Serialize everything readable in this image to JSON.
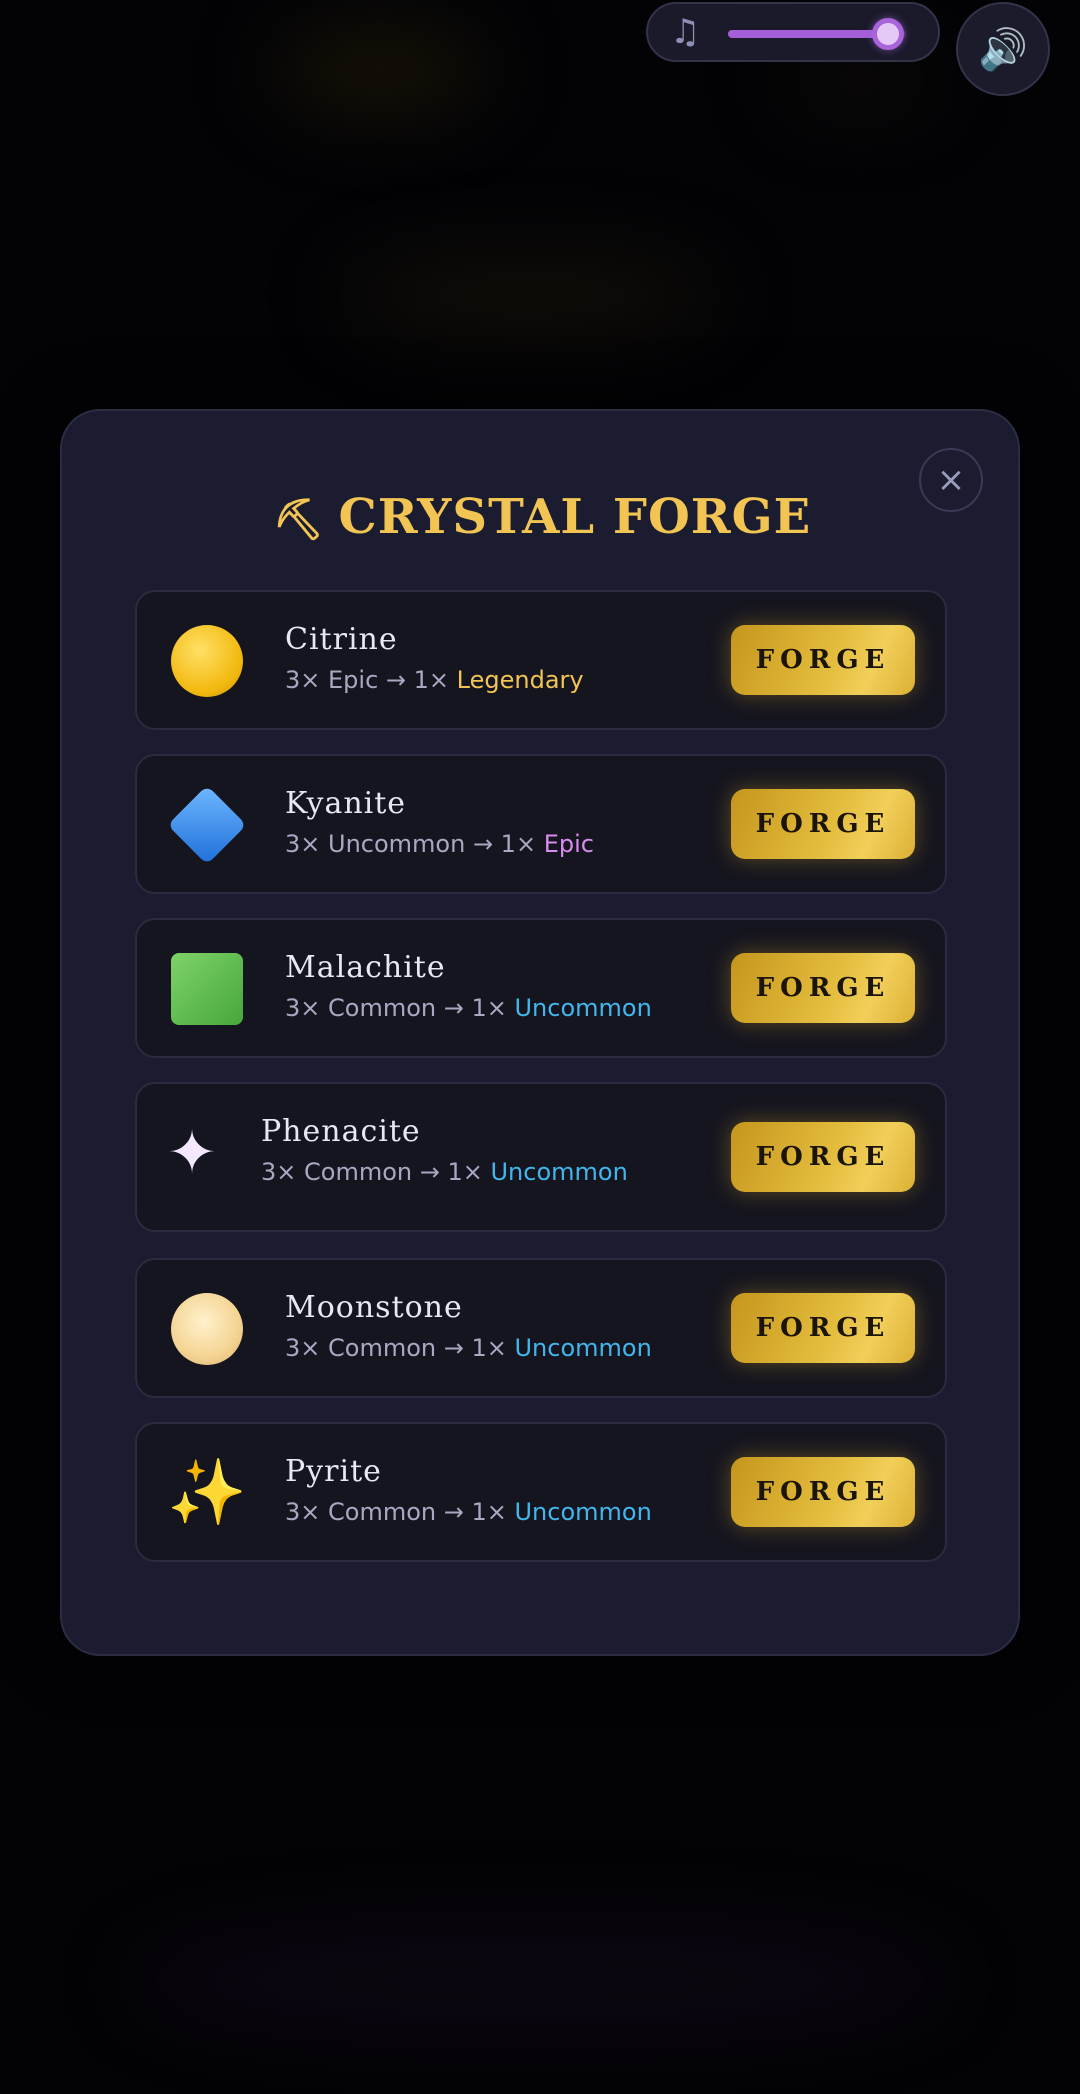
{
  "controls": {
    "music_icon": "music-note-icon",
    "music_volume": 0.9,
    "sound_icon": "speaker-icon",
    "colors": {
      "slider_fill": "#a55fd6",
      "slider_thumb": "#e4c8f6"
    }
  },
  "modal": {
    "title_icon": "⛏",
    "title": "CRYSTAL FORGE",
    "close_icon": "×",
    "colors": {
      "title": "#f1c453",
      "legendary": "#f1c453",
      "epic": "#d88cf0",
      "uncommon": "#42b6ec"
    },
    "recipes": [
      {
        "name": "Citrine",
        "icon": "citrine-gem-icon",
        "input": "3× Epic → 1× ",
        "output": "Legendary",
        "button": "FORGE"
      },
      {
        "name": "Kyanite",
        "icon": "kyanite-gem-icon",
        "input": "3× Uncommon → 1× ",
        "output": "Epic",
        "button": "FORGE"
      },
      {
        "name": "Malachite",
        "icon": "malachite-gem-icon",
        "input": "3× Common → 1× ",
        "output": "Uncommon",
        "button": "FORGE"
      },
      {
        "name": "Phenacite",
        "icon": "phenacite-sparkle-icon",
        "input": "3× Common → 1× ",
        "output": "Uncommon",
        "button": "FORGE"
      },
      {
        "name": "Moonstone",
        "icon": "moonstone-gem-icon",
        "input": "3× Common → 1× ",
        "output": "Uncommon",
        "button": "FORGE"
      },
      {
        "name": "Pyrite",
        "icon": "pyrite-sparkles-icon",
        "input": "3× Common → 1× ",
        "output": "Uncommon",
        "button": "FORGE"
      }
    ]
  }
}
